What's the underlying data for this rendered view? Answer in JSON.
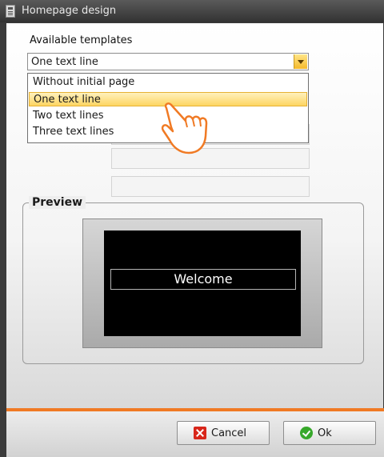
{
  "window": {
    "title": "Homepage design"
  },
  "templates": {
    "label": "Available templates",
    "selected": "One text line",
    "options": [
      "Without initial page",
      "One text line",
      "Two text lines",
      "Three text lines"
    ],
    "selected_index": 1
  },
  "preview": {
    "legend": "Preview",
    "screen_text": "Welcome"
  },
  "buttons": {
    "cancel": "Cancel",
    "ok": "Ok"
  },
  "icons": {
    "title": "document-icon",
    "dropdown": "chevron-down-icon",
    "cancel": "close-icon",
    "ok": "check-icon",
    "cursor": "hand-pointer-icon"
  },
  "colors": {
    "accent_line": "#f07a24",
    "highlight": "#fdd562",
    "screen": "#000000"
  }
}
